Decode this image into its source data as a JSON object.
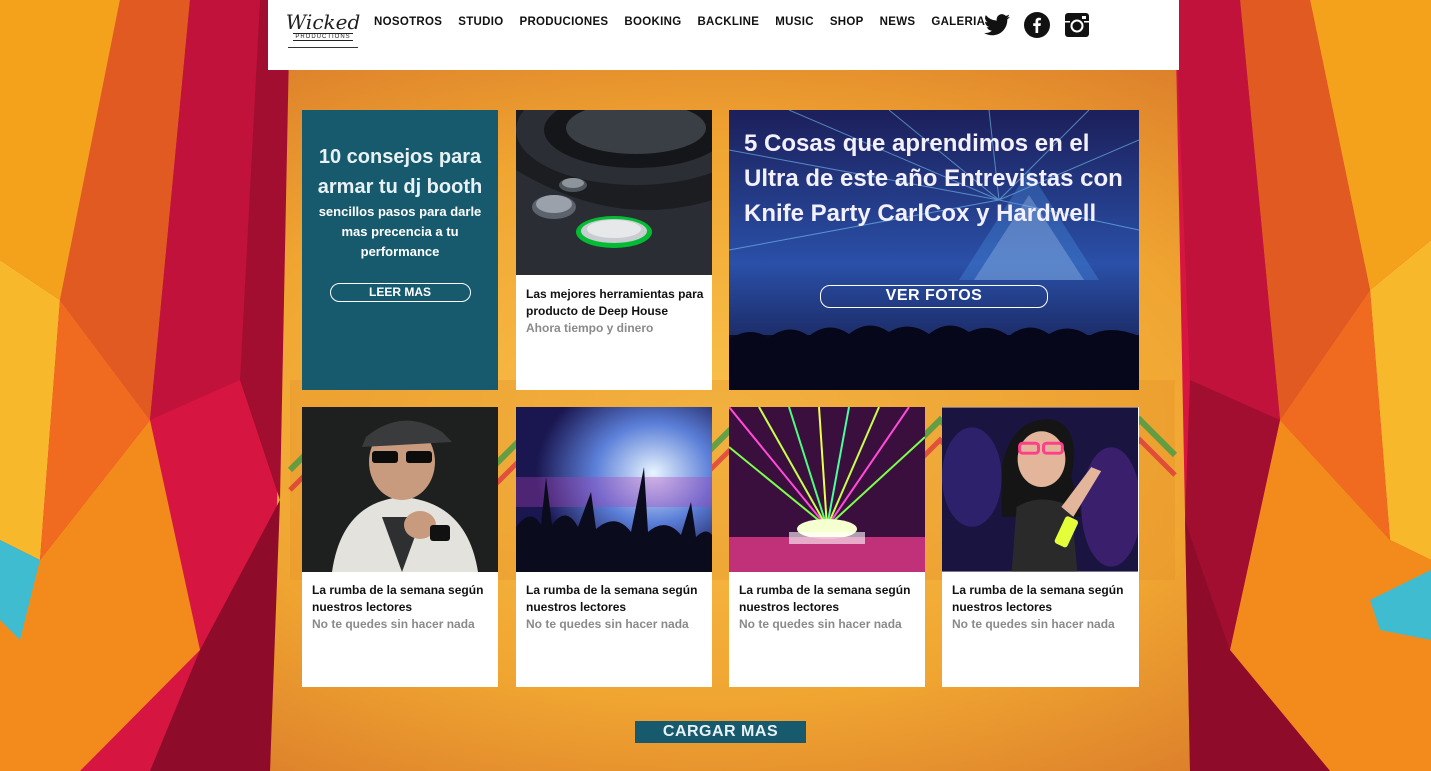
{
  "brand": {
    "logo_script": "Wicked",
    "logo_sub": "PRODUCTIONS"
  },
  "nav": [
    "NOSOTROS",
    "STUDIO",
    "PRODUCIONES",
    "BOOKING",
    "BACKLINE",
    "MUSIC",
    "SHOP",
    "NEWS",
    "GALERIA"
  ],
  "social": [
    "twitter-icon",
    "facebook-icon",
    "instagram-icon"
  ],
  "feature": {
    "title": "10 consejos para armar tu dj booth",
    "subtitle": "sencillos pasos para darle mas precencia a tu performance",
    "button": "LEER MAS"
  },
  "deep_house": {
    "title": "Las mejores herramientas para producto de Deep House",
    "subtitle": "Ahora tiempo y dinero"
  },
  "ultra": {
    "title": "5 Cosas que aprendimos en el Ultra de este año Entrevistas con Knife Party CarlCox y Hardwell",
    "button": "VER FOTOS"
  },
  "cards": [
    {
      "title": "La rumba de la semana según nuestros lectores",
      "subtitle": "No te quedes sin hacer nada"
    },
    {
      "title": "La rumba de la semana según nuestros lectores",
      "subtitle": "No te quedes sin hacer nada"
    },
    {
      "title": "La rumba de la semana según nuestros lectores",
      "subtitle": "No te quedes sin hacer nada"
    },
    {
      "title": "La rumba de la semana según nuestros lectores",
      "subtitle": "No te quedes sin hacer nada"
    }
  ],
  "load_more": "CARGAR MAS",
  "colors": {
    "teal": "#175a6e",
    "background": "#f0a531",
    "red": "#d61540"
  }
}
